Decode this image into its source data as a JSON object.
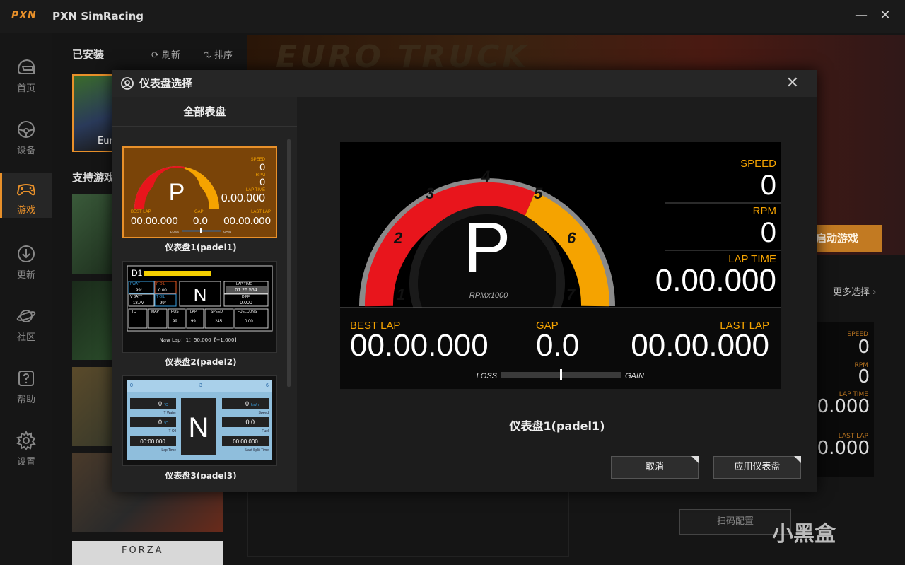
{
  "app": {
    "logo": "PXN",
    "title": "PXN SimRacing",
    "minimize": "—",
    "close": "✕"
  },
  "sidebar": {
    "items": [
      {
        "label": "首页",
        "icon": "helmet-icon"
      },
      {
        "label": "设备",
        "icon": "wheel-icon"
      },
      {
        "label": "游戏",
        "icon": "gamepad-icon"
      },
      {
        "label": "更新",
        "icon": "download-icon"
      },
      {
        "label": "社区",
        "icon": "planet-icon"
      },
      {
        "label": "帮助",
        "icon": "help-icon"
      },
      {
        "label": "设置",
        "icon": "gear-icon"
      }
    ],
    "active": "游戏"
  },
  "library": {
    "installed_title": "已安装",
    "refresh": "⟳ 刷新",
    "sort": "⇅ 排序",
    "installed_game_caption": "Eur",
    "supported_title": "支持游戏",
    "hero_title": "EURO TRUCK",
    "launch_label": "启动游戏",
    "more_select": "更多选择 ›",
    "scan_config": "扫码配置",
    "watermark": "小黑盒",
    "bottom_game_text": "FORZA"
  },
  "bg_dash": {
    "speed_label": "SPEED",
    "speed_value": "0",
    "rpm_label": "RPM",
    "rpm_value": "0",
    "laptime_label": "LAP TIME",
    "laptime_value": "0.000",
    "lastlap_label": "LAST LAP",
    "lastlap_value": "0.000"
  },
  "modal": {
    "title": "仪表盘选择",
    "close": "✕",
    "left_header": "全部表盘",
    "cards": [
      {
        "caption": "仪表盘1(padel1)"
      },
      {
        "caption": "仪表盘2(padel2)"
      },
      {
        "caption": "仪表盘3(padel3)"
      }
    ],
    "preview_caption": "仪表盘1(padel1)",
    "cancel": "取消",
    "apply": "应用仪表盘"
  },
  "dash1": {
    "gear": "P",
    "rpm_unit": "RPMx1000",
    "ticks": [
      "1",
      "2",
      "3",
      "4",
      "5",
      "6",
      "7"
    ],
    "speed_label": "SPEED",
    "speed": "0",
    "rpm_label": "RPM",
    "rpm": "0",
    "laptime_label": "LAP TIME",
    "laptime": "0.00.000",
    "best_label": "BEST LAP",
    "best": "00.00.000",
    "gap_label": "GAP",
    "gap": "0.0",
    "last_label": "LAST LAP",
    "last": "00.00.000",
    "loss": "LOSS",
    "gain": "GAIN",
    "colors": {
      "red": "#e8151c",
      "orange": "#f5a300",
      "accent": "#e8902a"
    }
  },
  "dash2": {
    "title": "D1",
    "pwat_label": "PWAT",
    "pwat": "99°",
    "poil_label": "P OIL",
    "poil": "0.00",
    "vbatt_label": "V BATT",
    "vbatt": "13.7V",
    "toil_label": "T OIL",
    "toil": "99°",
    "gear": "N",
    "laptime_label": "LAP TIME",
    "laptime": "01:26:564",
    "diff_label": "DIFF",
    "diff": "0.000",
    "tc_label": "TC",
    "map_label": "MAP",
    "pos_label": "POS",
    "pos": "99",
    "lap_label": "LAP",
    "lap": "99",
    "speed_label": "SPEED",
    "speed": "245",
    "fuel_label": "FUELCONS",
    "fuel": "0.00",
    "newlap": "Naw Lap：1：50.000【+1.000】"
  },
  "dash3": {
    "scale_left": "0",
    "scale_mid": "3",
    "scale_right": "6",
    "twater": "0",
    "twater_unit": "°C",
    "twater_label": "T Water",
    "toil": "0",
    "toil_unit": "°C",
    "toil_label": "T Oil",
    "laptime": "00:00.000",
    "laptime_label": "Lap Time",
    "gear": "N",
    "speed": "0",
    "speed_unit": "km/h",
    "speed_label": "Speed",
    "fuel": "0.0",
    "fuel_unit": "L",
    "fuel_label": "Fuel",
    "split": "00:00.000",
    "split_label": "Last Split Time"
  }
}
